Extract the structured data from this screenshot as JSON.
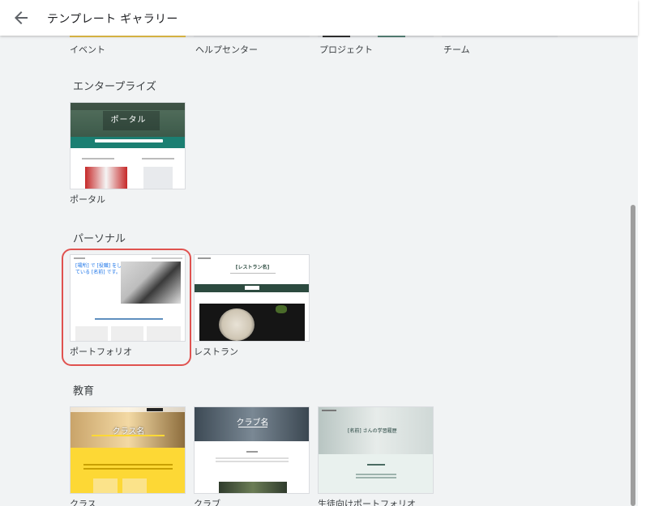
{
  "header": {
    "title": "テンプレート ギャラリー",
    "back_icon": "arrow-back-icon"
  },
  "top_row": [
    "イベント",
    "ヘルプセンター",
    "プロジェクト",
    "チーム"
  ],
  "sections": {
    "enterprise": {
      "title": "エンタープライズ",
      "items": [
        {
          "label": "ポータル",
          "thumb_title": "ポータル"
        }
      ]
    },
    "personal": {
      "title": "パーソナル",
      "items": [
        {
          "label": "ポートフォリオ",
          "thumb_title": "[場所] で [役職] をしている [名前] です。"
        },
        {
          "label": "レストラン",
          "thumb_title": "[レストラン名]"
        }
      ]
    },
    "education": {
      "title": "教育",
      "items": [
        {
          "label": "クラス",
          "thumb_title": "クラス名"
        },
        {
          "label": "クラブ",
          "thumb_title": "クラブ名"
        },
        {
          "label": "生徒向けポートフォリオ",
          "thumb_title": "[名前] さんの学習履歴"
        }
      ]
    }
  },
  "colors": {
    "highlight": "#e0524f",
    "teal": "#127a6e",
    "dark_green": "#2c4a3f",
    "yellow": "#fdd835"
  }
}
